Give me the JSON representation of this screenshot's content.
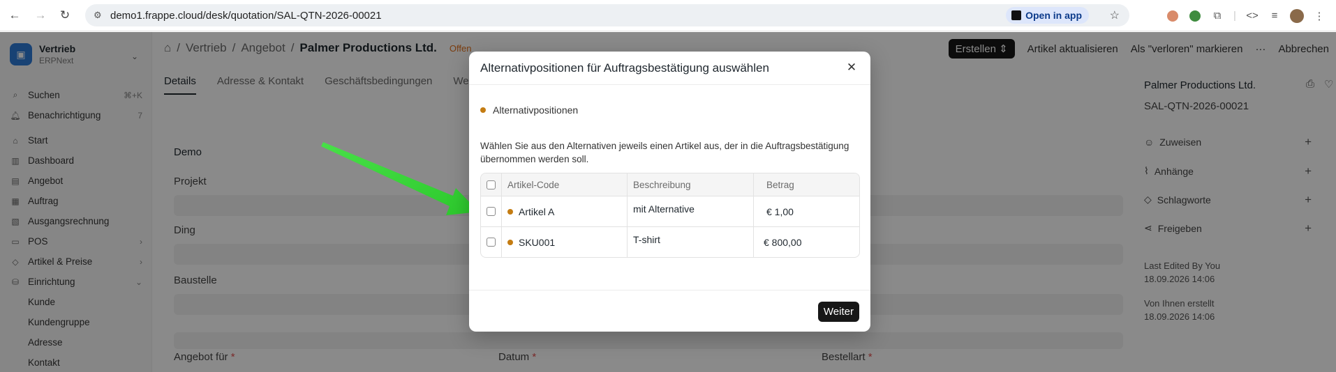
{
  "browser": {
    "url": "demo1.frappe.cloud/desk/quotation/SAL-QTN-2026-00021",
    "open_in_app": "Open in app"
  },
  "sidebar": {
    "workspace_name": "Vertrieb",
    "workspace_sub": "ERPNext",
    "search_label": "Suchen",
    "search_shortcut": "⌘+K",
    "notifications_label": "Benachrichtigung",
    "notifications_count": "7",
    "items": [
      {
        "label": "Start"
      },
      {
        "label": "Dashboard"
      },
      {
        "label": "Angebot"
      },
      {
        "label": "Auftrag"
      },
      {
        "label": "Ausgangsrechnung"
      },
      {
        "label": "POS"
      },
      {
        "label": "Artikel & Preise"
      },
      {
        "label": "Einrichtung"
      }
    ],
    "sub_items": [
      {
        "label": "Kunde"
      },
      {
        "label": "Kundengruppe"
      },
      {
        "label": "Adresse"
      },
      {
        "label": "Kontakt"
      }
    ]
  },
  "header": {
    "breadcrumb": [
      "Vertrieb",
      "Angebot"
    ],
    "current": "Palmer Productions Ltd.",
    "status": "Offen",
    "actions": {
      "create": "Erstellen",
      "update_items": "Artikel aktualisieren",
      "mark_lost": "Als \"verloren\" markieren",
      "more": "···",
      "cancel": "Abbrechen"
    }
  },
  "tabs": [
    "Details",
    "Adresse & Kontakt",
    "Geschäftsbedingungen",
    "Wei"
  ],
  "form": {
    "section": "Demo",
    "fields": [
      "Projekt",
      "Ding",
      "Baustelle"
    ],
    "bottom_labels": [
      "Angebot für",
      "Datum",
      "Bestellart"
    ],
    "required_marker": "*"
  },
  "right_panel": {
    "title": "Palmer Productions Ltd.",
    "doc_id": "SAL-QTN-2026-00021",
    "rows": [
      "Zuweisen",
      "Anhänge",
      "Schlagworte",
      "Freigeben"
    ],
    "last_edited_label": "Last Edited By You",
    "last_edited_date": "18.09.2026 14:06",
    "created_label": "Von Ihnen erstellt",
    "created_date": "18.09.2026 14:06"
  },
  "modal": {
    "title": "Alternativpositionen für Auftragsbestätigung auswählen",
    "indicator": "Alternativpositionen",
    "description": "Wählen Sie aus den Alternativen jeweils einen Artikel aus, der in die Auftragsbestätigung übernommen werden soll.",
    "columns": [
      "Artikel-Code",
      "Beschreibung",
      "Betrag"
    ],
    "rows": [
      {
        "code": "Artikel A",
        "description": "mit Alternative",
        "amount": "€ 1,00"
      },
      {
        "code": "SKU001",
        "description": "T-shirt",
        "amount": "€ 800,00"
      }
    ],
    "primary_button": "Weiter"
  },
  "colors": {
    "indicator_orange": "#c47c12",
    "status_orange": "#e2711d",
    "arrow_green": "#3ddc3d",
    "primary_dark": "#171717"
  }
}
